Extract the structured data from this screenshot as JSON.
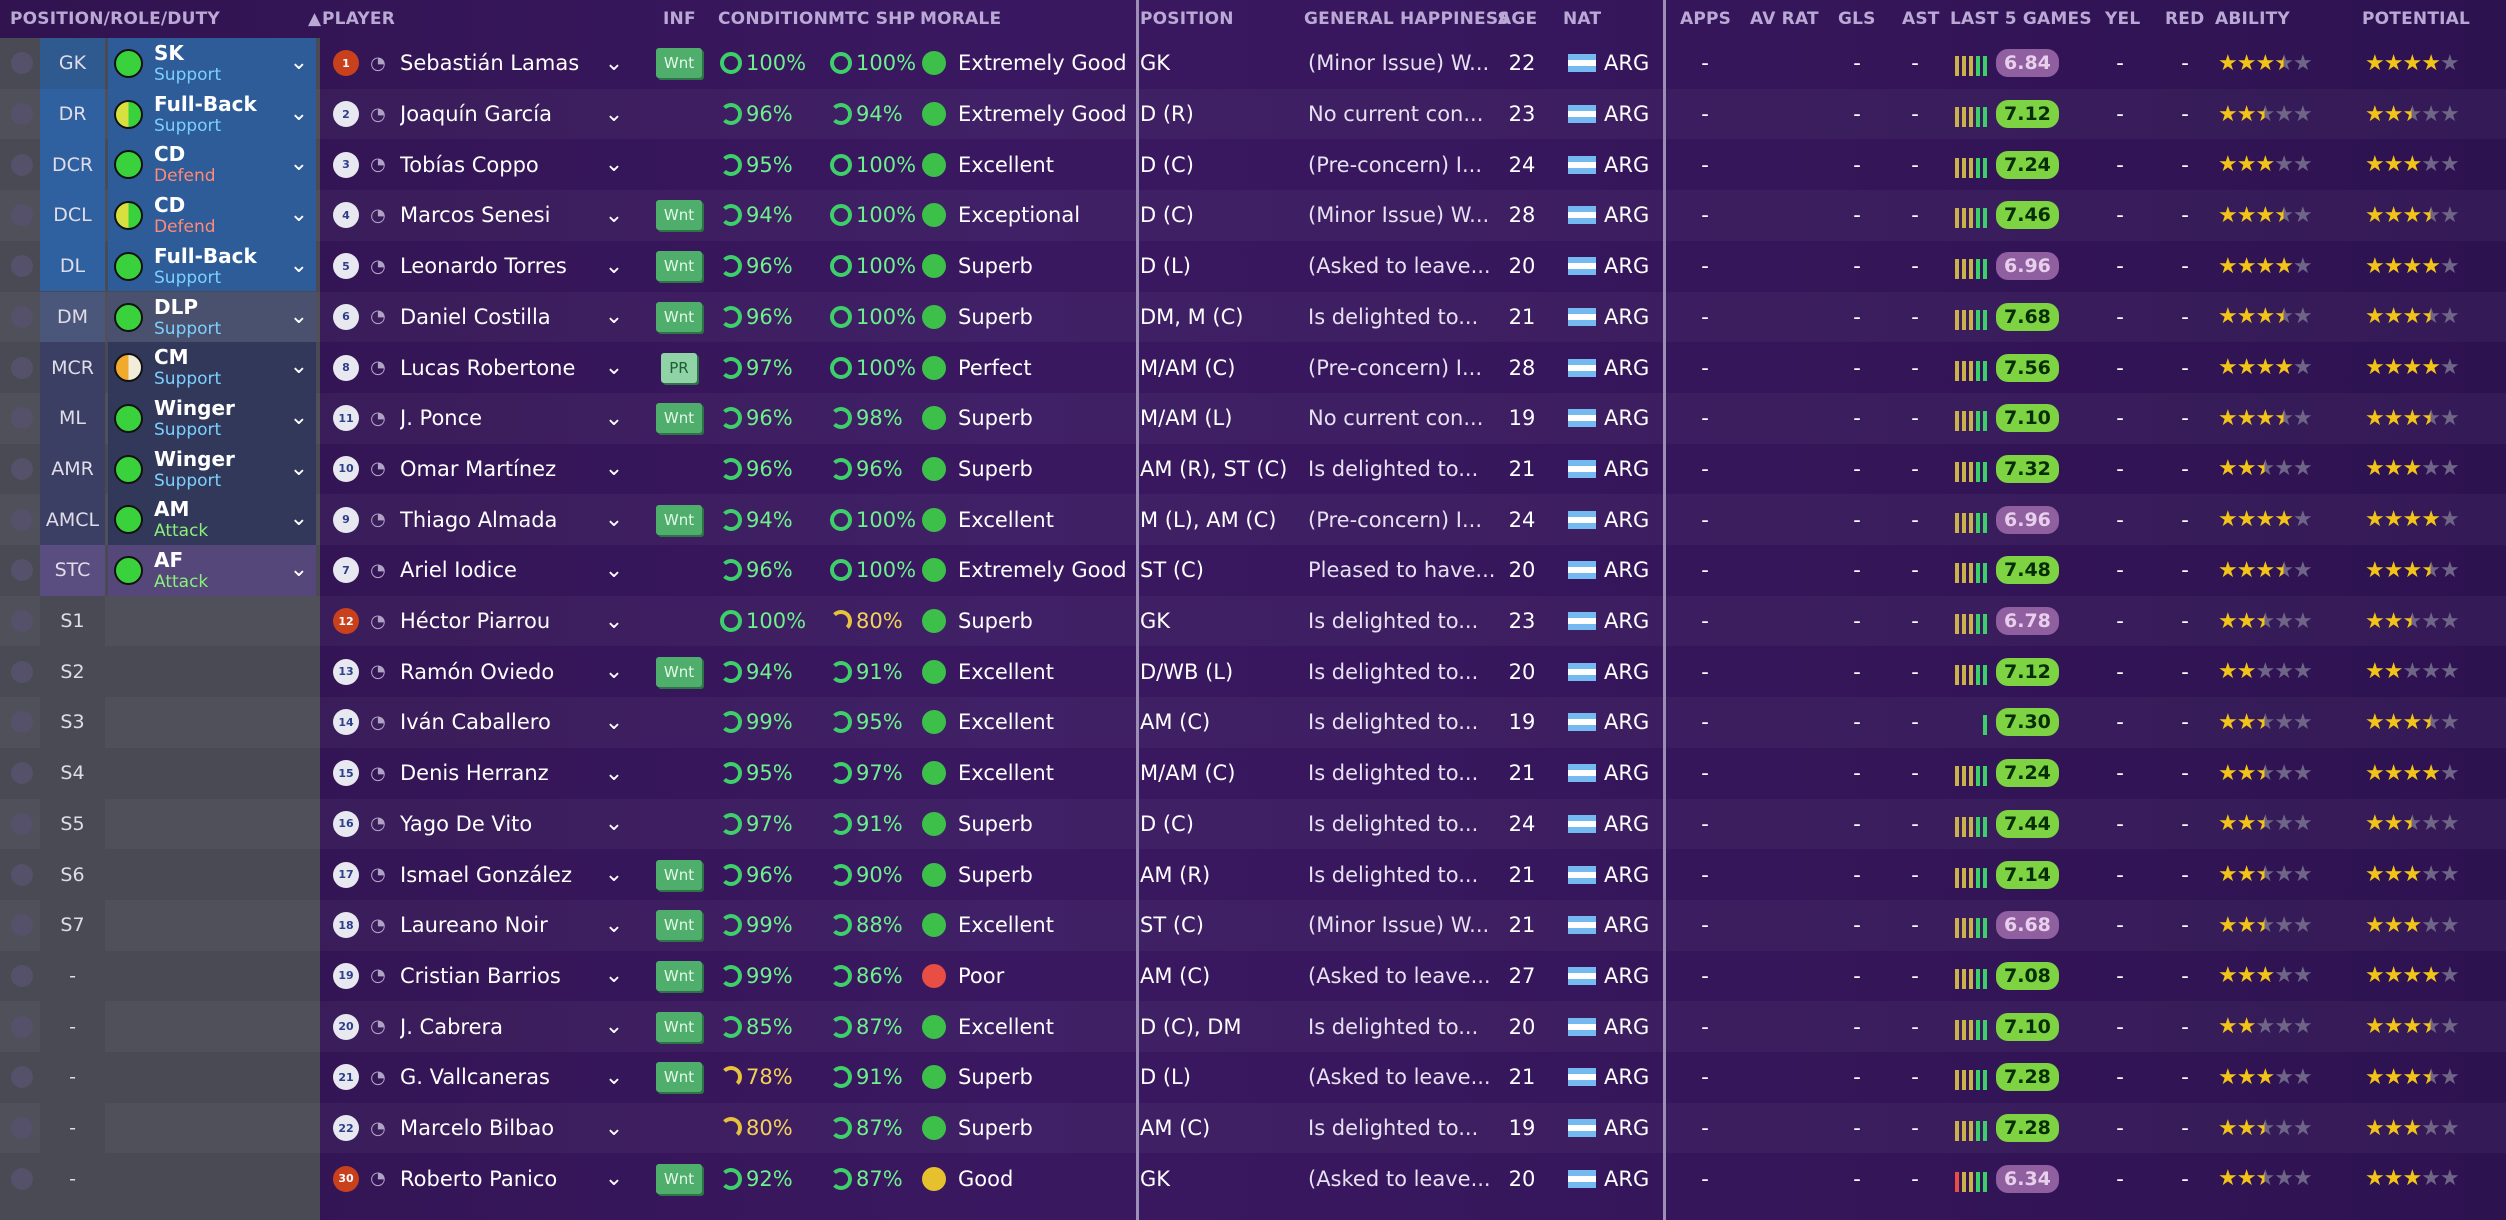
{
  "columns": {
    "position_role_duty": "POSITION/ROLE/DUTY",
    "player": "PLAYER",
    "inf": "INF",
    "condition": "CONDITION",
    "mtc_shp": "MTC SHP",
    "morale": "MORALE",
    "position": "POSITION",
    "general_happiness": "GENERAL HAPPINESS",
    "age": "AGE",
    "nat": "NAT",
    "apps": "APPS",
    "av_rat": "AV RAT",
    "gls": "GLS",
    "ast": "AST",
    "last5": "LAST 5 GAMES",
    "yel": "YEL",
    "red": "RED",
    "ability": "ABILITY",
    "potential": "POTENTIAL"
  },
  "sort_arrow": "▲",
  "colors": {
    "accent_green": "#3dd06a",
    "star": "#f2c318",
    "background": "#30134f"
  },
  "rows": [
    {
      "pos": "GK",
      "role": "SK",
      "duty": "Support",
      "duty_type": "support",
      "kit": "1",
      "gk": true,
      "name": "Sebastián Lamas",
      "inf": "Wnt",
      "condition": "100%",
      "cond_ring": "full",
      "shp": "100%",
      "shp_ring": "full",
      "morale": "Extremely Good",
      "mood": "good-green",
      "position": "GK",
      "happiness": "(Minor Issue) W...",
      "age": "22",
      "nat": "ARG",
      "apps": "-",
      "avrat": "",
      "gls": "-",
      "ast": "-",
      "bars": 5,
      "rating": "6.84",
      "rating_poor": true,
      "yel": "-",
      "red": "-",
      "ability": 3.5,
      "potential": 4.0
    },
    {
      "pos": "DR",
      "role": "Full-Back",
      "duty": "Support",
      "duty_type": "support",
      "kit": "2",
      "name": "Joaquín García",
      "inf": "",
      "condition": "96%",
      "cond_ring": "mid",
      "shp": "94%",
      "shp_ring": "mid",
      "morale": "Extremely Good",
      "mood": "good-green",
      "position": "D (R)",
      "happiness": "No current con...",
      "age": "23",
      "nat": "ARG",
      "apps": "-",
      "avrat": "",
      "gls": "-",
      "ast": "-",
      "bars": 5,
      "rating": "7.12",
      "yel": "-",
      "red": "-",
      "ability": 2.5,
      "potential": 2.5
    },
    {
      "pos": "DCR",
      "role": "CD",
      "duty": "Defend",
      "duty_type": "defend",
      "kit": "3",
      "name": "Tobías Coppo",
      "inf": "",
      "condition": "95%",
      "cond_ring": "mid",
      "shp": "100%",
      "shp_ring": "full",
      "morale": "Excellent",
      "mood": "good-green",
      "position": "D (C)",
      "happiness": "(Pre-concern) I...",
      "age": "24",
      "nat": "ARG",
      "apps": "-",
      "avrat": "",
      "gls": "-",
      "ast": "-",
      "bars": 5,
      "rating": "7.24",
      "yel": "-",
      "red": "-",
      "ability": 3.0,
      "potential": 3.0
    },
    {
      "pos": "DCL",
      "role": "CD",
      "duty": "Defend",
      "duty_type": "defend",
      "kit": "4",
      "name": "Marcos Senesi",
      "inf": "Wnt",
      "condition": "94%",
      "cond_ring": "mid",
      "shp": "100%",
      "shp_ring": "full",
      "morale": "Exceptional",
      "mood": "good-green",
      "position": "D (C)",
      "happiness": "(Minor Issue) W...",
      "age": "28",
      "nat": "ARG",
      "apps": "-",
      "avrat": "",
      "gls": "-",
      "ast": "-",
      "bars": 5,
      "rating": "7.46",
      "yel": "-",
      "red": "-",
      "ability": 3.5,
      "potential": 3.5
    },
    {
      "pos": "DL",
      "role": "Full-Back",
      "duty": "Support",
      "duty_type": "support",
      "kit": "5",
      "name": "Leonardo Torres",
      "inf": "Wnt",
      "condition": "96%",
      "cond_ring": "mid",
      "shp": "100%",
      "shp_ring": "full",
      "morale": "Superb",
      "mood": "good-green",
      "position": "D (L)",
      "happiness": "(Asked to leave...",
      "age": "20",
      "nat": "ARG",
      "apps": "-",
      "avrat": "",
      "gls": "-",
      "ast": "-",
      "bars": 5,
      "rating": "6.96",
      "rating_poor": true,
      "yel": "-",
      "red": "-",
      "ability": 4.0,
      "potential": 4.0
    },
    {
      "pos": "DM",
      "role": "DLP",
      "duty": "Support",
      "duty_type": "support",
      "kit": "6",
      "name": "Daniel Costilla",
      "inf": "Wnt",
      "condition": "96%",
      "cond_ring": "mid",
      "shp": "100%",
      "shp_ring": "full",
      "morale": "Superb",
      "mood": "good-green",
      "position": "DM, M (C)",
      "happiness": "Is delighted to...",
      "age": "21",
      "nat": "ARG",
      "apps": "-",
      "avrat": "",
      "gls": "-",
      "ast": "-",
      "bars": 5,
      "rating": "7.68",
      "yel": "-",
      "red": "-",
      "ability": 3.5,
      "potential": 3.5
    },
    {
      "pos": "MCR",
      "role": "CM",
      "duty": "Support",
      "duty_type": "support",
      "kit": "8",
      "name": "Lucas Robertone",
      "inf": "PR",
      "condition": "97%",
      "cond_ring": "mid",
      "shp": "100%",
      "shp_ring": "full",
      "morale": "Perfect",
      "mood": "good-green",
      "position": "M/AM (C)",
      "happiness": "(Pre-concern) I...",
      "age": "28",
      "nat": "ARG",
      "apps": "-",
      "avrat": "",
      "gls": "-",
      "ast": "-",
      "bars": 5,
      "rating": "7.56",
      "yel": "-",
      "red": "-",
      "ability": 4.0,
      "potential": 4.0
    },
    {
      "pos": "ML",
      "role": "Winger",
      "duty": "Support",
      "duty_type": "support",
      "kit": "11",
      "name": "J. Ponce",
      "inf": "Wnt",
      "condition": "96%",
      "cond_ring": "mid",
      "shp": "98%",
      "shp_ring": "mid",
      "morale": "Superb",
      "mood": "good-green",
      "position": "M/AM (L)",
      "happiness": "No current con...",
      "age": "19",
      "nat": "ARG",
      "apps": "-",
      "avrat": "",
      "gls": "-",
      "ast": "-",
      "bars": 5,
      "rating": "7.10",
      "yel": "-",
      "red": "-",
      "ability": 3.5,
      "potential": 3.5
    },
    {
      "pos": "AMR",
      "role": "Winger",
      "duty": "Support",
      "duty_type": "support",
      "kit": "10",
      "name": "Omar Martínez",
      "inf": "",
      "condition": "96%",
      "cond_ring": "mid",
      "shp": "96%",
      "shp_ring": "mid",
      "morale": "Superb",
      "mood": "good-green",
      "position": "AM (R), ST (C)",
      "happiness": "Is delighted to...",
      "age": "21",
      "nat": "ARG",
      "apps": "-",
      "avrat": "",
      "gls": "-",
      "ast": "-",
      "bars": 5,
      "rating": "7.32",
      "yel": "-",
      "red": "-",
      "ability": 2.5,
      "potential": 3.0
    },
    {
      "pos": "AMCL",
      "role": "AM",
      "duty": "Attack",
      "duty_type": "attack",
      "kit": "9",
      "name": "Thiago Almada",
      "inf": "Wnt",
      "condition": "94%",
      "cond_ring": "mid",
      "shp": "100%",
      "shp_ring": "full",
      "morale": "Excellent",
      "mood": "good-green",
      "position": "M (L), AM (C)",
      "happiness": "(Pre-concern) I...",
      "age": "24",
      "nat": "ARG",
      "apps": "-",
      "avrat": "",
      "gls": "-",
      "ast": "-",
      "bars": 5,
      "rating": "6.96",
      "rating_poor": true,
      "yel": "-",
      "red": "-",
      "ability": 4.0,
      "potential": 4.0
    },
    {
      "pos": "STC",
      "role": "AF",
      "duty": "Attack",
      "duty_type": "attack",
      "kit": "7",
      "name": "Ariel Iodice",
      "inf": "",
      "condition": "96%",
      "cond_ring": "mid",
      "shp": "100%",
      "shp_ring": "full",
      "morale": "Extremely Good",
      "mood": "good-green",
      "position": "ST (C)",
      "happiness": "Pleased to have...",
      "age": "20",
      "nat": "ARG",
      "apps": "-",
      "avrat": "",
      "gls": "-",
      "ast": "-",
      "bars": 5,
      "rating": "7.48",
      "yel": "-",
      "red": "-",
      "ability": 3.5,
      "potential": 3.5
    },
    {
      "pos": "S1",
      "kit": "12",
      "gk": true,
      "name": "Héctor Piarrou",
      "inf": "",
      "condition": "100%",
      "cond_ring": "full",
      "shp": "80%",
      "shp_ring": "low",
      "morale": "Superb",
      "mood": "good-green",
      "position": "GK",
      "happiness": "Is delighted to...",
      "age": "23",
      "nat": "ARG",
      "apps": "-",
      "avrat": "",
      "gls": "-",
      "ast": "-",
      "bars": 5,
      "rating": "6.78",
      "rating_poor": true,
      "yel": "-",
      "red": "-",
      "ability": 2.5,
      "potential": 2.5
    },
    {
      "pos": "S2",
      "kit": "13",
      "name": "Ramón Oviedo",
      "inf": "Wnt",
      "condition": "94%",
      "cond_ring": "mid",
      "shp": "91%",
      "shp_ring": "mid",
      "morale": "Excellent",
      "mood": "good-green",
      "position": "D/WB (L)",
      "happiness": "Is delighted to...",
      "age": "20",
      "nat": "ARG",
      "apps": "-",
      "avrat": "",
      "gls": "-",
      "ast": "-",
      "bars": 5,
      "rating": "7.12",
      "yel": "-",
      "red": "-",
      "ability": 2.0,
      "potential": 2.0
    },
    {
      "pos": "S3",
      "kit": "14",
      "name": "Iván Caballero",
      "inf": "",
      "condition": "99%",
      "cond_ring": "mid",
      "shp": "95%",
      "shp_ring": "mid",
      "morale": "Excellent",
      "mood": "good-green",
      "position": "AM (C)",
      "happiness": "Is delighted to...",
      "age": "19",
      "nat": "ARG",
      "apps": "-",
      "avrat": "",
      "gls": "-",
      "ast": "-",
      "bars": 1,
      "rating": "7.30",
      "yel": "-",
      "red": "-",
      "ability": 2.5,
      "potential": 3.5
    },
    {
      "pos": "S4",
      "kit": "15",
      "name": "Denis Herranz",
      "inf": "",
      "condition": "95%",
      "cond_ring": "mid",
      "shp": "97%",
      "shp_ring": "mid",
      "morale": "Excellent",
      "mood": "good-green",
      "position": "M/AM (C)",
      "happiness": "Is delighted to...",
      "age": "21",
      "nat": "ARG",
      "apps": "-",
      "avrat": "",
      "gls": "-",
      "ast": "-",
      "bars": 5,
      "rating": "7.24",
      "yel": "-",
      "red": "-",
      "ability": 2.5,
      "potential": 4.0
    },
    {
      "pos": "S5",
      "kit": "16",
      "name": "Yago De Vito",
      "inf": "",
      "condition": "97%",
      "cond_ring": "mid",
      "shp": "91%",
      "shp_ring": "mid",
      "morale": "Superb",
      "mood": "good-green",
      "position": "D (C)",
      "happiness": "Is delighted to...",
      "age": "24",
      "nat": "ARG",
      "apps": "-",
      "avrat": "",
      "gls": "-",
      "ast": "-",
      "bars": 5,
      "rating": "7.44",
      "yel": "-",
      "red": "-",
      "ability": 2.5,
      "potential": 2.5
    },
    {
      "pos": "S6",
      "kit": "17",
      "name": "Ismael González",
      "inf": "Wnt",
      "condition": "96%",
      "cond_ring": "mid",
      "shp": "90%",
      "shp_ring": "mid",
      "morale": "Superb",
      "mood": "good-green",
      "position": "AM (R)",
      "happiness": "Is delighted to...",
      "age": "21",
      "nat": "ARG",
      "apps": "-",
      "avrat": "",
      "gls": "-",
      "ast": "-",
      "bars": 5,
      "rating": "7.14",
      "yel": "-",
      "red": "-",
      "ability": 2.5,
      "potential": 3.0
    },
    {
      "pos": "S7",
      "kit": "18",
      "name": "Laureano Noir",
      "inf": "Wnt",
      "condition": "99%",
      "cond_ring": "mid",
      "shp": "88%",
      "shp_ring": "mid",
      "morale": "Excellent",
      "mood": "good-green",
      "position": "ST (C)",
      "happiness": "(Minor Issue) W...",
      "age": "21",
      "nat": "ARG",
      "apps": "-",
      "avrat": "",
      "gls": "-",
      "ast": "-",
      "bars": 5,
      "rating": "6.68",
      "rating_poor": true,
      "yel": "-",
      "red": "-",
      "ability": 2.5,
      "potential": 3.0
    },
    {
      "pos": "-",
      "kit": "19",
      "name": "Cristian Barrios",
      "inf": "Wnt",
      "condition": "99%",
      "cond_ring": "mid",
      "shp": "86%",
      "shp_ring": "mid",
      "morale": "Poor",
      "mood": "poor",
      "position": "AM (C)",
      "happiness": "(Asked to leave...",
      "age": "27",
      "nat": "ARG",
      "apps": "-",
      "avrat": "",
      "gls": "-",
      "ast": "-",
      "bars": 5,
      "rating": "7.08",
      "yel": "-",
      "red": "-",
      "ability": 3.0,
      "potential": 4.0
    },
    {
      "pos": "-",
      "kit": "20",
      "name": "J. Cabrera",
      "inf": "Wnt",
      "condition": "85%",
      "cond_ring": "mid",
      "shp": "87%",
      "shp_ring": "mid",
      "morale": "Excellent",
      "mood": "good-green",
      "position": "D (C), DM",
      "happiness": "Is delighted to...",
      "age": "20",
      "nat": "ARG",
      "apps": "-",
      "avrat": "",
      "gls": "-",
      "ast": "-",
      "bars": 5,
      "rating": "7.10",
      "yel": "-",
      "red": "-",
      "ability": 2.0,
      "potential": 3.5
    },
    {
      "pos": "-",
      "kit": "21",
      "name": "G. Vallcaneras",
      "inf": "Wnt",
      "condition": "78%",
      "cond_ring": "low",
      "shp": "91%",
      "shp_ring": "mid",
      "morale": "Superb",
      "mood": "good-green",
      "position": "D (L)",
      "happiness": "(Asked to leave...",
      "age": "21",
      "nat": "ARG",
      "apps": "-",
      "avrat": "",
      "gls": "-",
      "ast": "-",
      "bars": 5,
      "rating": "7.28",
      "yel": "-",
      "red": "-",
      "ability": 3.0,
      "potential": 3.5
    },
    {
      "pos": "-",
      "kit": "22",
      "name": "Marcelo Bilbao",
      "inf": "",
      "condition": "80%",
      "cond_ring": "low",
      "shp": "87%",
      "shp_ring": "mid",
      "morale": "Superb",
      "mood": "good-green",
      "position": "AM (C)",
      "happiness": "Is delighted to...",
      "age": "19",
      "nat": "ARG",
      "apps": "-",
      "avrat": "",
      "gls": "-",
      "ast": "-",
      "bars": 5,
      "rating": "7.28",
      "yel": "-",
      "red": "-",
      "ability": 2.5,
      "potential": 3.0
    },
    {
      "pos": "-",
      "kit": "30",
      "gk": true,
      "name": "Roberto Panico",
      "inf": "Wnt",
      "condition": "92%",
      "cond_ring": "mid",
      "shp": "87%",
      "shp_ring": "mid",
      "morale": "Good",
      "mood": "good",
      "position": "GK",
      "happiness": "(Asked to leave...",
      "age": "20",
      "nat": "ARG",
      "apps": "-",
      "avrat": "",
      "gls": "-",
      "ast": "-",
      "bars": 5,
      "rating": "6.34",
      "rating_poor": true,
      "yel": "-",
      "red": "-",
      "ability": 2.5,
      "potential": 3.0
    }
  ]
}
